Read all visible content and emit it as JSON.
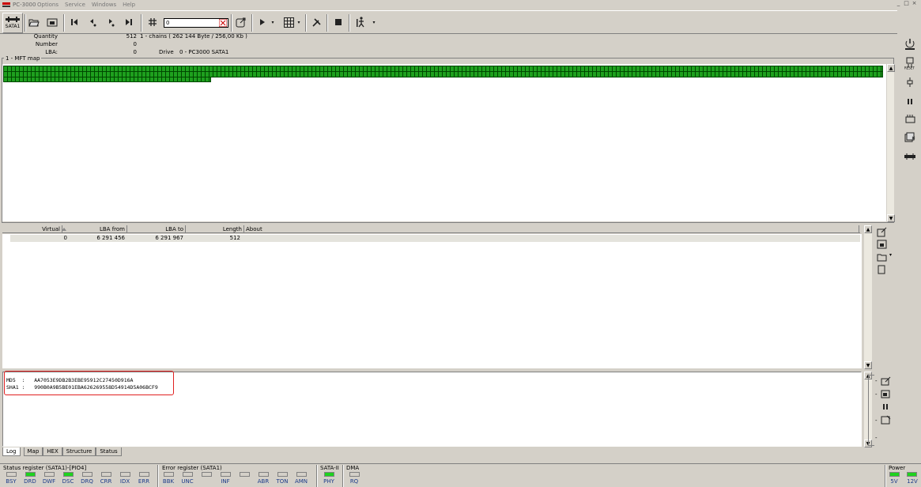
{
  "window": {
    "title": "PC-3000",
    "minimize": "_",
    "maximize": "□",
    "close": "×"
  },
  "menu": [
    "Options",
    "Service",
    "Windows",
    "Help"
  ],
  "toolbar": {
    "sata_label": "SATA1",
    "lba_input": "0"
  },
  "info": {
    "quantity_label": "Quantity",
    "quantity_value": "512",
    "chains": "1 - chains  (  262 144 Byte /  256,00 Kb )",
    "number_label": "Number",
    "number_value": "0",
    "lba_label": "LBA:",
    "lba_value": "0",
    "drive_label": "Drive",
    "drive_value": "0 - PC3000 SATA1"
  },
  "mft": {
    "label": "1 - MFT map"
  },
  "table": {
    "headers": [
      "Virtual",
      "LBA from",
      "LBA to",
      "Length",
      "About"
    ],
    "rows": [
      {
        "virtual": "0",
        "lba_from": "6 291 456",
        "lba_to": "6 291 967",
        "length": "512",
        "about": ""
      }
    ]
  },
  "log": {
    "lines": [
      "MD5  :   AA7053E9DB2B3EBE95912C27450D916A",
      "SHA1 :   990B0A9B5BE01EBA626269558D54914D5A06BCF9"
    ]
  },
  "tabs": [
    "Log",
    "Map",
    "HEX",
    "Structure",
    "Status"
  ],
  "status": {
    "status_reg_label": "Status register (SATA1)-[PIO4]",
    "status_leds": [
      {
        "label": "BSY",
        "on": false
      },
      {
        "label": "DRD",
        "on": true
      },
      {
        "label": "DWF",
        "on": false
      },
      {
        "label": "DSC",
        "on": true
      },
      {
        "label": "DRQ",
        "on": false
      },
      {
        "label": "CRR",
        "on": false
      },
      {
        "label": "IDX",
        "on": false
      },
      {
        "label": "ERR",
        "on": false
      }
    ],
    "error_reg_label": "Error register (SATA1)",
    "error_leds": [
      {
        "label": "BBK",
        "on": false
      },
      {
        "label": "UNC",
        "on": false
      },
      {
        "label": "",
        "on": false
      },
      {
        "label": "INF",
        "on": false
      },
      {
        "label": "",
        "on": false
      },
      {
        "label": "ABR",
        "on": false
      },
      {
        "label": "TON",
        "on": false
      },
      {
        "label": "AMN",
        "on": false
      }
    ],
    "sata_label": "SATA-II",
    "phy_label": "PHY",
    "dma_label": "DMA",
    "rq_label": "RQ",
    "power_label": "Power",
    "v5_label": "5V",
    "v12_label": "12V"
  },
  "colors": {
    "led_on": "#1ed21e",
    "mft_block": "#1ea01e",
    "highlight": "#e02020"
  }
}
